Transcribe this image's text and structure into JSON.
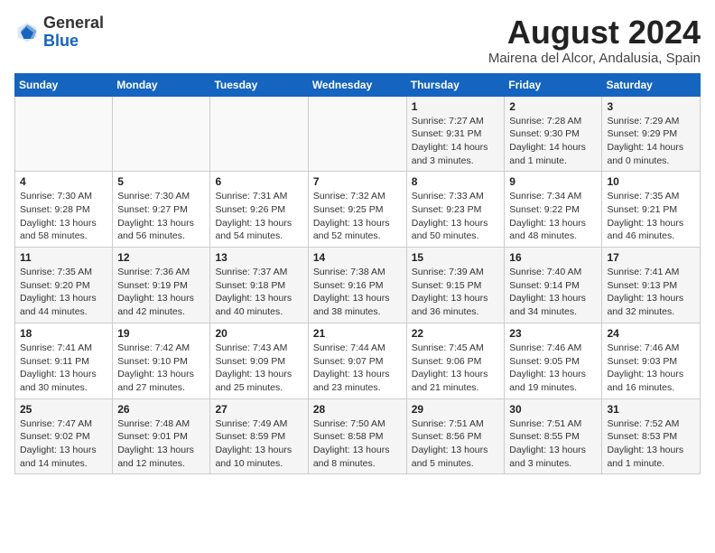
{
  "logo": {
    "general": "General",
    "blue": "Blue"
  },
  "title": "August 2024",
  "location": "Mairena del Alcor, Andalusia, Spain",
  "days_of_week": [
    "Sunday",
    "Monday",
    "Tuesday",
    "Wednesday",
    "Thursday",
    "Friday",
    "Saturday"
  ],
  "weeks": [
    [
      {
        "empty": true
      },
      {
        "empty": true
      },
      {
        "empty": true
      },
      {
        "empty": true
      },
      {
        "day": 1,
        "sunrise": "7:27 AM",
        "sunset": "9:31 PM",
        "daylight": "14 hours and 3 minutes."
      },
      {
        "day": 2,
        "sunrise": "7:28 AM",
        "sunset": "9:30 PM",
        "daylight": "14 hours and 1 minute."
      },
      {
        "day": 3,
        "sunrise": "7:29 AM",
        "sunset": "9:29 PM",
        "daylight": "14 hours and 0 minutes."
      }
    ],
    [
      {
        "day": 4,
        "sunrise": "7:30 AM",
        "sunset": "9:28 PM",
        "daylight": "13 hours and 58 minutes."
      },
      {
        "day": 5,
        "sunrise": "7:30 AM",
        "sunset": "9:27 PM",
        "daylight": "13 hours and 56 minutes."
      },
      {
        "day": 6,
        "sunrise": "7:31 AM",
        "sunset": "9:26 PM",
        "daylight": "13 hours and 54 minutes."
      },
      {
        "day": 7,
        "sunrise": "7:32 AM",
        "sunset": "9:25 PM",
        "daylight": "13 hours and 52 minutes."
      },
      {
        "day": 8,
        "sunrise": "7:33 AM",
        "sunset": "9:23 PM",
        "daylight": "13 hours and 50 minutes."
      },
      {
        "day": 9,
        "sunrise": "7:34 AM",
        "sunset": "9:22 PM",
        "daylight": "13 hours and 48 minutes."
      },
      {
        "day": 10,
        "sunrise": "7:35 AM",
        "sunset": "9:21 PM",
        "daylight": "13 hours and 46 minutes."
      }
    ],
    [
      {
        "day": 11,
        "sunrise": "7:35 AM",
        "sunset": "9:20 PM",
        "daylight": "13 hours and 44 minutes."
      },
      {
        "day": 12,
        "sunrise": "7:36 AM",
        "sunset": "9:19 PM",
        "daylight": "13 hours and 42 minutes."
      },
      {
        "day": 13,
        "sunrise": "7:37 AM",
        "sunset": "9:18 PM",
        "daylight": "13 hours and 40 minutes."
      },
      {
        "day": 14,
        "sunrise": "7:38 AM",
        "sunset": "9:16 PM",
        "daylight": "13 hours and 38 minutes."
      },
      {
        "day": 15,
        "sunrise": "7:39 AM",
        "sunset": "9:15 PM",
        "daylight": "13 hours and 36 minutes."
      },
      {
        "day": 16,
        "sunrise": "7:40 AM",
        "sunset": "9:14 PM",
        "daylight": "13 hours and 34 minutes."
      },
      {
        "day": 17,
        "sunrise": "7:41 AM",
        "sunset": "9:13 PM",
        "daylight": "13 hours and 32 minutes."
      }
    ],
    [
      {
        "day": 18,
        "sunrise": "7:41 AM",
        "sunset": "9:11 PM",
        "daylight": "13 hours and 30 minutes."
      },
      {
        "day": 19,
        "sunrise": "7:42 AM",
        "sunset": "9:10 PM",
        "daylight": "13 hours and 27 minutes."
      },
      {
        "day": 20,
        "sunrise": "7:43 AM",
        "sunset": "9:09 PM",
        "daylight": "13 hours and 25 minutes."
      },
      {
        "day": 21,
        "sunrise": "7:44 AM",
        "sunset": "9:07 PM",
        "daylight": "13 hours and 23 minutes."
      },
      {
        "day": 22,
        "sunrise": "7:45 AM",
        "sunset": "9:06 PM",
        "daylight": "13 hours and 21 minutes."
      },
      {
        "day": 23,
        "sunrise": "7:46 AM",
        "sunset": "9:05 PM",
        "daylight": "13 hours and 19 minutes."
      },
      {
        "day": 24,
        "sunrise": "7:46 AM",
        "sunset": "9:03 PM",
        "daylight": "13 hours and 16 minutes."
      }
    ],
    [
      {
        "day": 25,
        "sunrise": "7:47 AM",
        "sunset": "9:02 PM",
        "daylight": "13 hours and 14 minutes."
      },
      {
        "day": 26,
        "sunrise": "7:48 AM",
        "sunset": "9:01 PM",
        "daylight": "13 hours and 12 minutes."
      },
      {
        "day": 27,
        "sunrise": "7:49 AM",
        "sunset": "8:59 PM",
        "daylight": "13 hours and 10 minutes."
      },
      {
        "day": 28,
        "sunrise": "7:50 AM",
        "sunset": "8:58 PM",
        "daylight": "13 hours and 8 minutes."
      },
      {
        "day": 29,
        "sunrise": "7:51 AM",
        "sunset": "8:56 PM",
        "daylight": "13 hours and 5 minutes."
      },
      {
        "day": 30,
        "sunrise": "7:51 AM",
        "sunset": "8:55 PM",
        "daylight": "13 hours and 3 minutes."
      },
      {
        "day": 31,
        "sunrise": "7:52 AM",
        "sunset": "8:53 PM",
        "daylight": "13 hours and 1 minute."
      }
    ]
  ]
}
